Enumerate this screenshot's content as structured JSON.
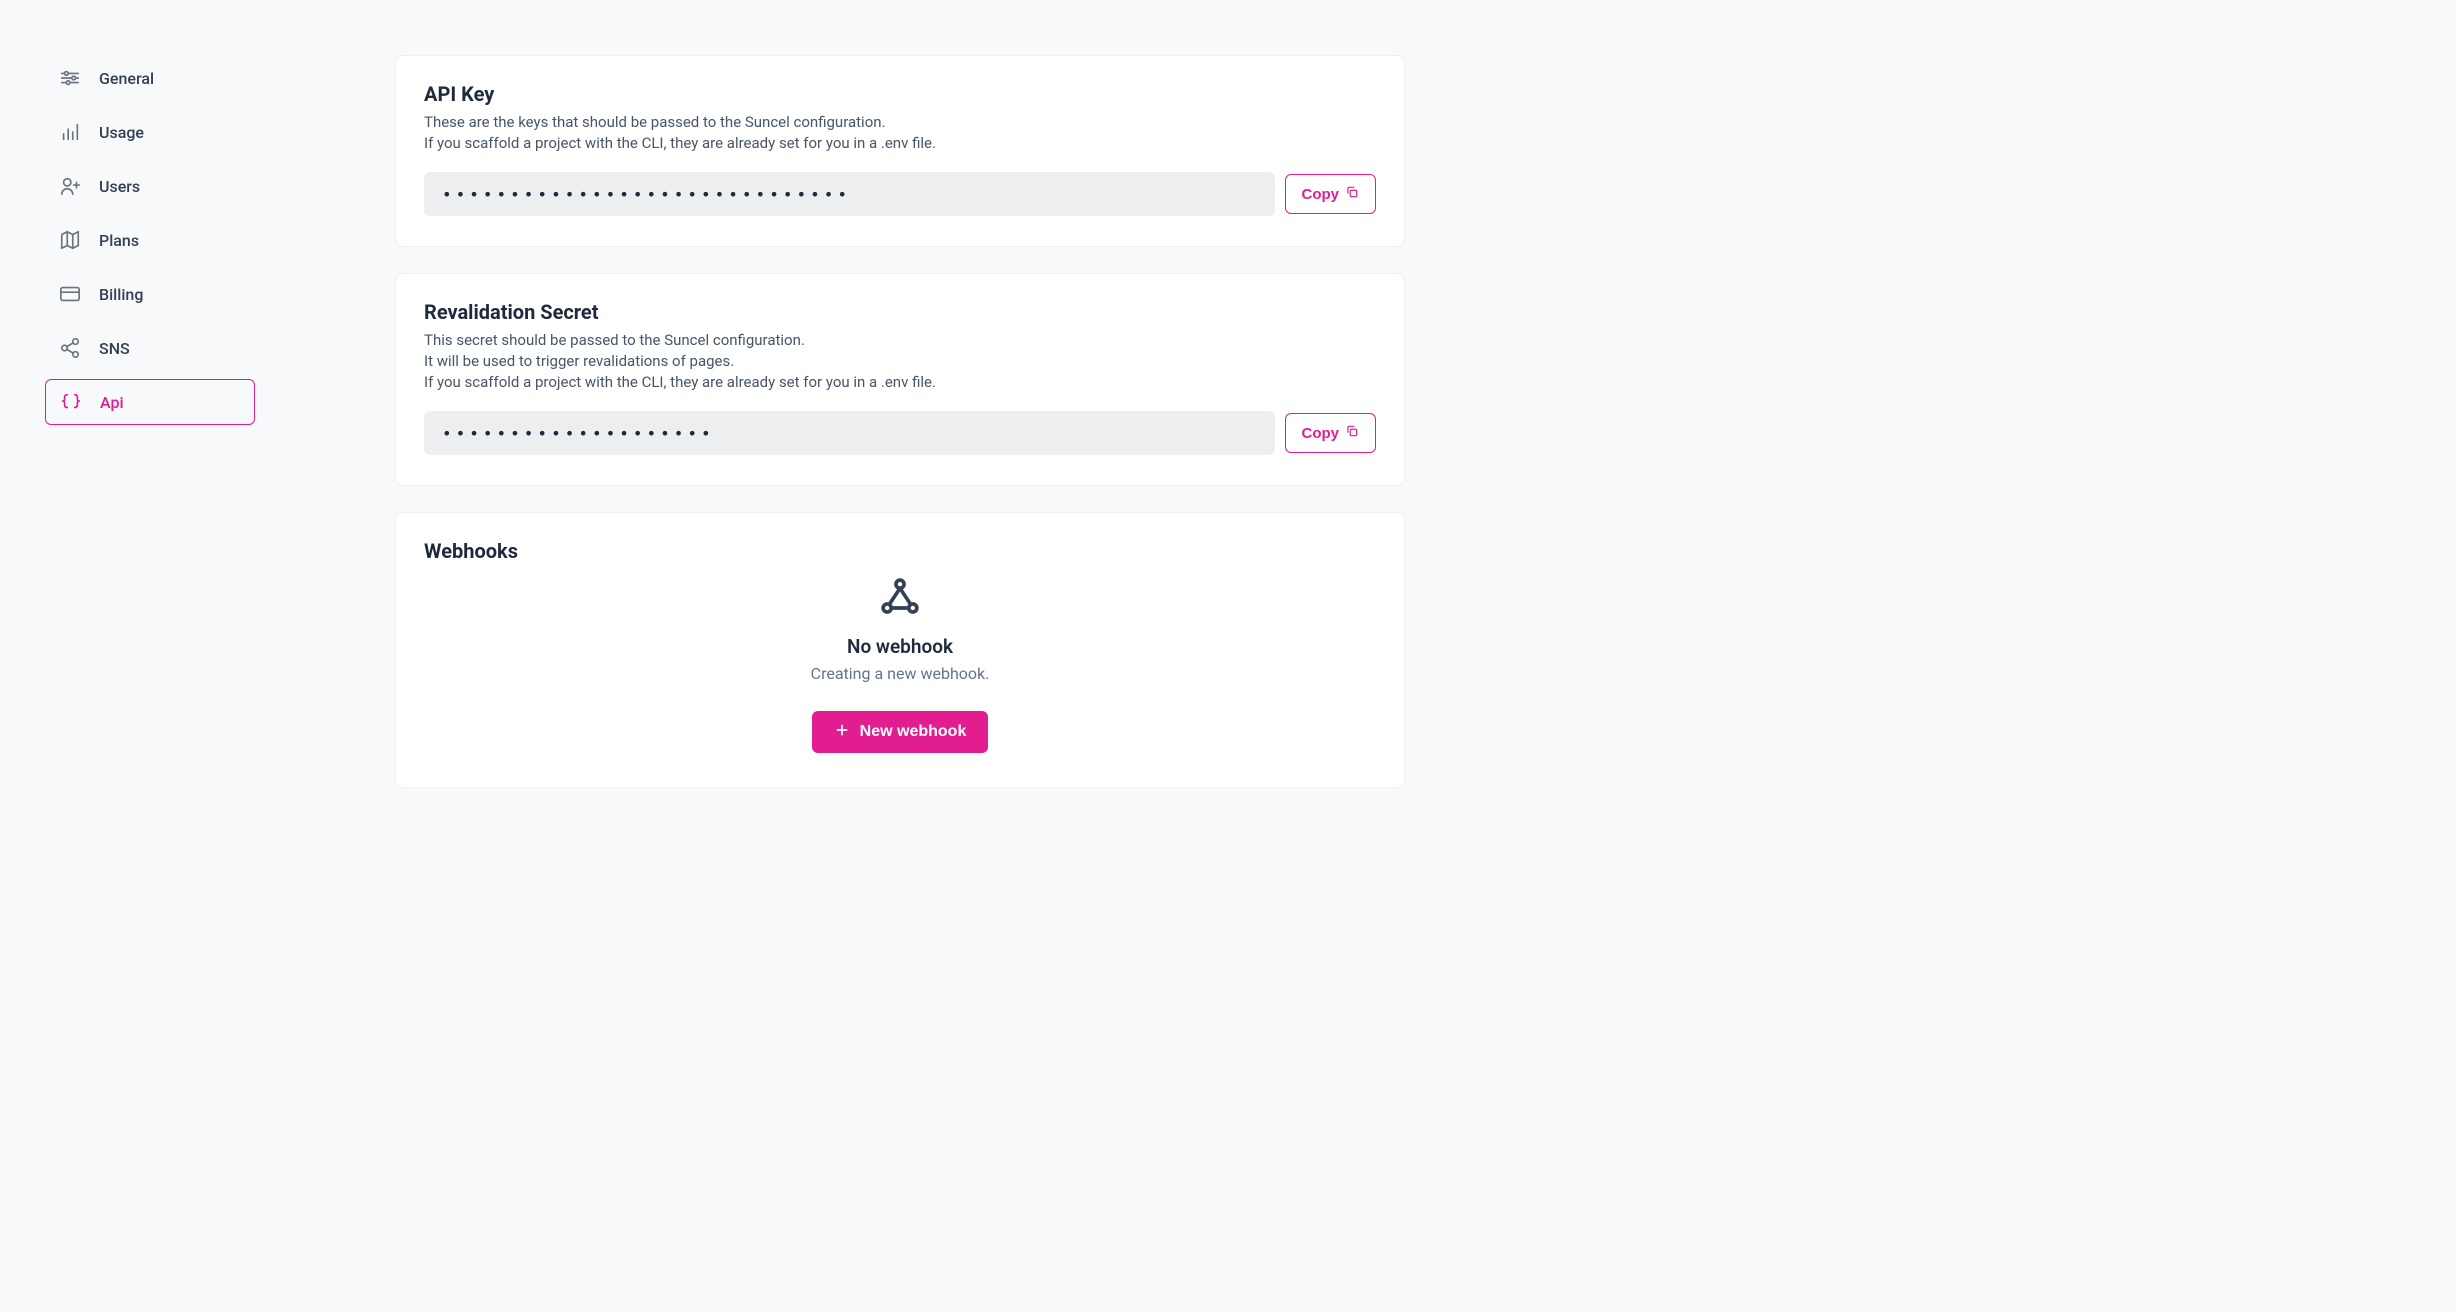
{
  "sidebar": {
    "items": [
      {
        "label": "General"
      },
      {
        "label": "Usage"
      },
      {
        "label": "Users"
      },
      {
        "label": "Plans"
      },
      {
        "label": "Billing"
      },
      {
        "label": "SNS"
      },
      {
        "label": "Api"
      }
    ]
  },
  "apiKey": {
    "title": "API Key",
    "description": "These are the keys that should be passed to the Suncel configuration.\nIf you scaffold a project with the CLI, they are already set for you in a .env file.",
    "masked": "••••••••••••••••••••••••••••••",
    "copyLabel": "Copy"
  },
  "revalidation": {
    "title": "Revalidation Secret",
    "description": "This secret should be passed to the Suncel configuration.\nIt will be used to trigger revalidations of pages.\nIf you scaffold a project with the CLI, they are already set for you in a .env file.",
    "masked": "••••••••••••••••••••",
    "copyLabel": "Copy"
  },
  "webhooks": {
    "title": "Webhooks",
    "emptyTitle": "No webhook",
    "emptySub": "Creating a new webhook.",
    "newButton": "New webhook"
  }
}
